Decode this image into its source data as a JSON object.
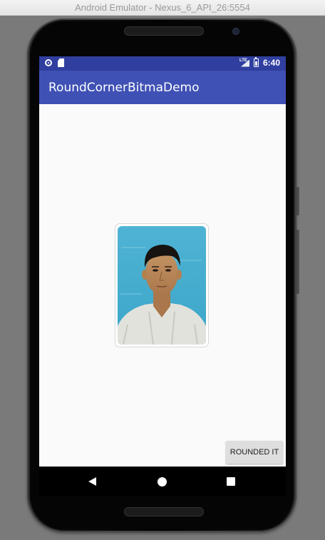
{
  "window": {
    "title": "Android Emulator - Nexus_6_API_26:5554"
  },
  "statusbar": {
    "time": "6:40",
    "network_label": "LTE",
    "icons": [
      "notification-circle-icon",
      "sd-card-icon",
      "lte-signal-icon",
      "battery-icon"
    ],
    "background_color": "#303f9f"
  },
  "appbar": {
    "title": "RoundCornerBitmaDemo",
    "background_color": "#3f51b5"
  },
  "main": {
    "photo_alt": "Portrait photo with rounded corners",
    "button_label": "ROUNDED IT"
  },
  "navbar": {
    "icons": [
      "back-icon",
      "home-icon",
      "recents-icon"
    ]
  }
}
